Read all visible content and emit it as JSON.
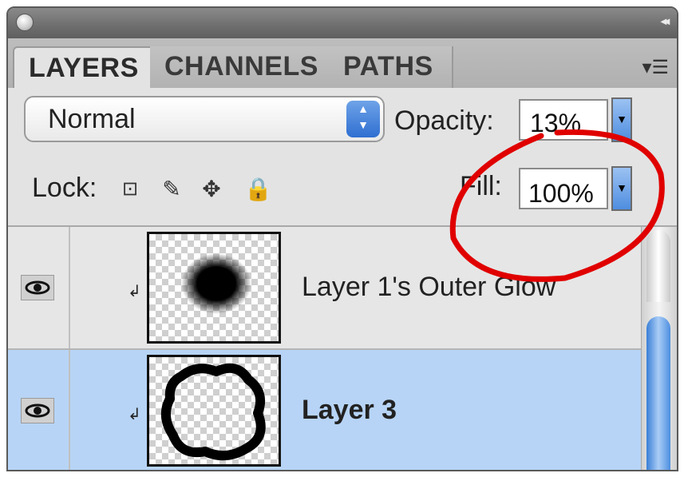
{
  "tabs": [
    {
      "label": "LAYERS",
      "active": true
    },
    {
      "label": "CHANNELS",
      "active": false
    },
    {
      "label": "PATHS",
      "active": false
    }
  ],
  "blend_mode": {
    "value": "Normal"
  },
  "opacity": {
    "label": "Opacity:",
    "value": "13%"
  },
  "lock": {
    "label": "Lock:",
    "icons": [
      "lock-transparent-pixels-icon",
      "lock-image-pixels-icon",
      "lock-position-icon",
      "lock-all-icon"
    ]
  },
  "fill": {
    "label": "Fill:",
    "value": "100%"
  },
  "layers": [
    {
      "name": "Layer 1's Outer Glow",
      "selected": false,
      "visible": true
    },
    {
      "name": "Layer 3",
      "selected": true,
      "visible": true
    }
  ],
  "colors": {
    "selection": "#b7d4f6",
    "annotation": "#e00000",
    "accent": "#2f6fd1"
  }
}
